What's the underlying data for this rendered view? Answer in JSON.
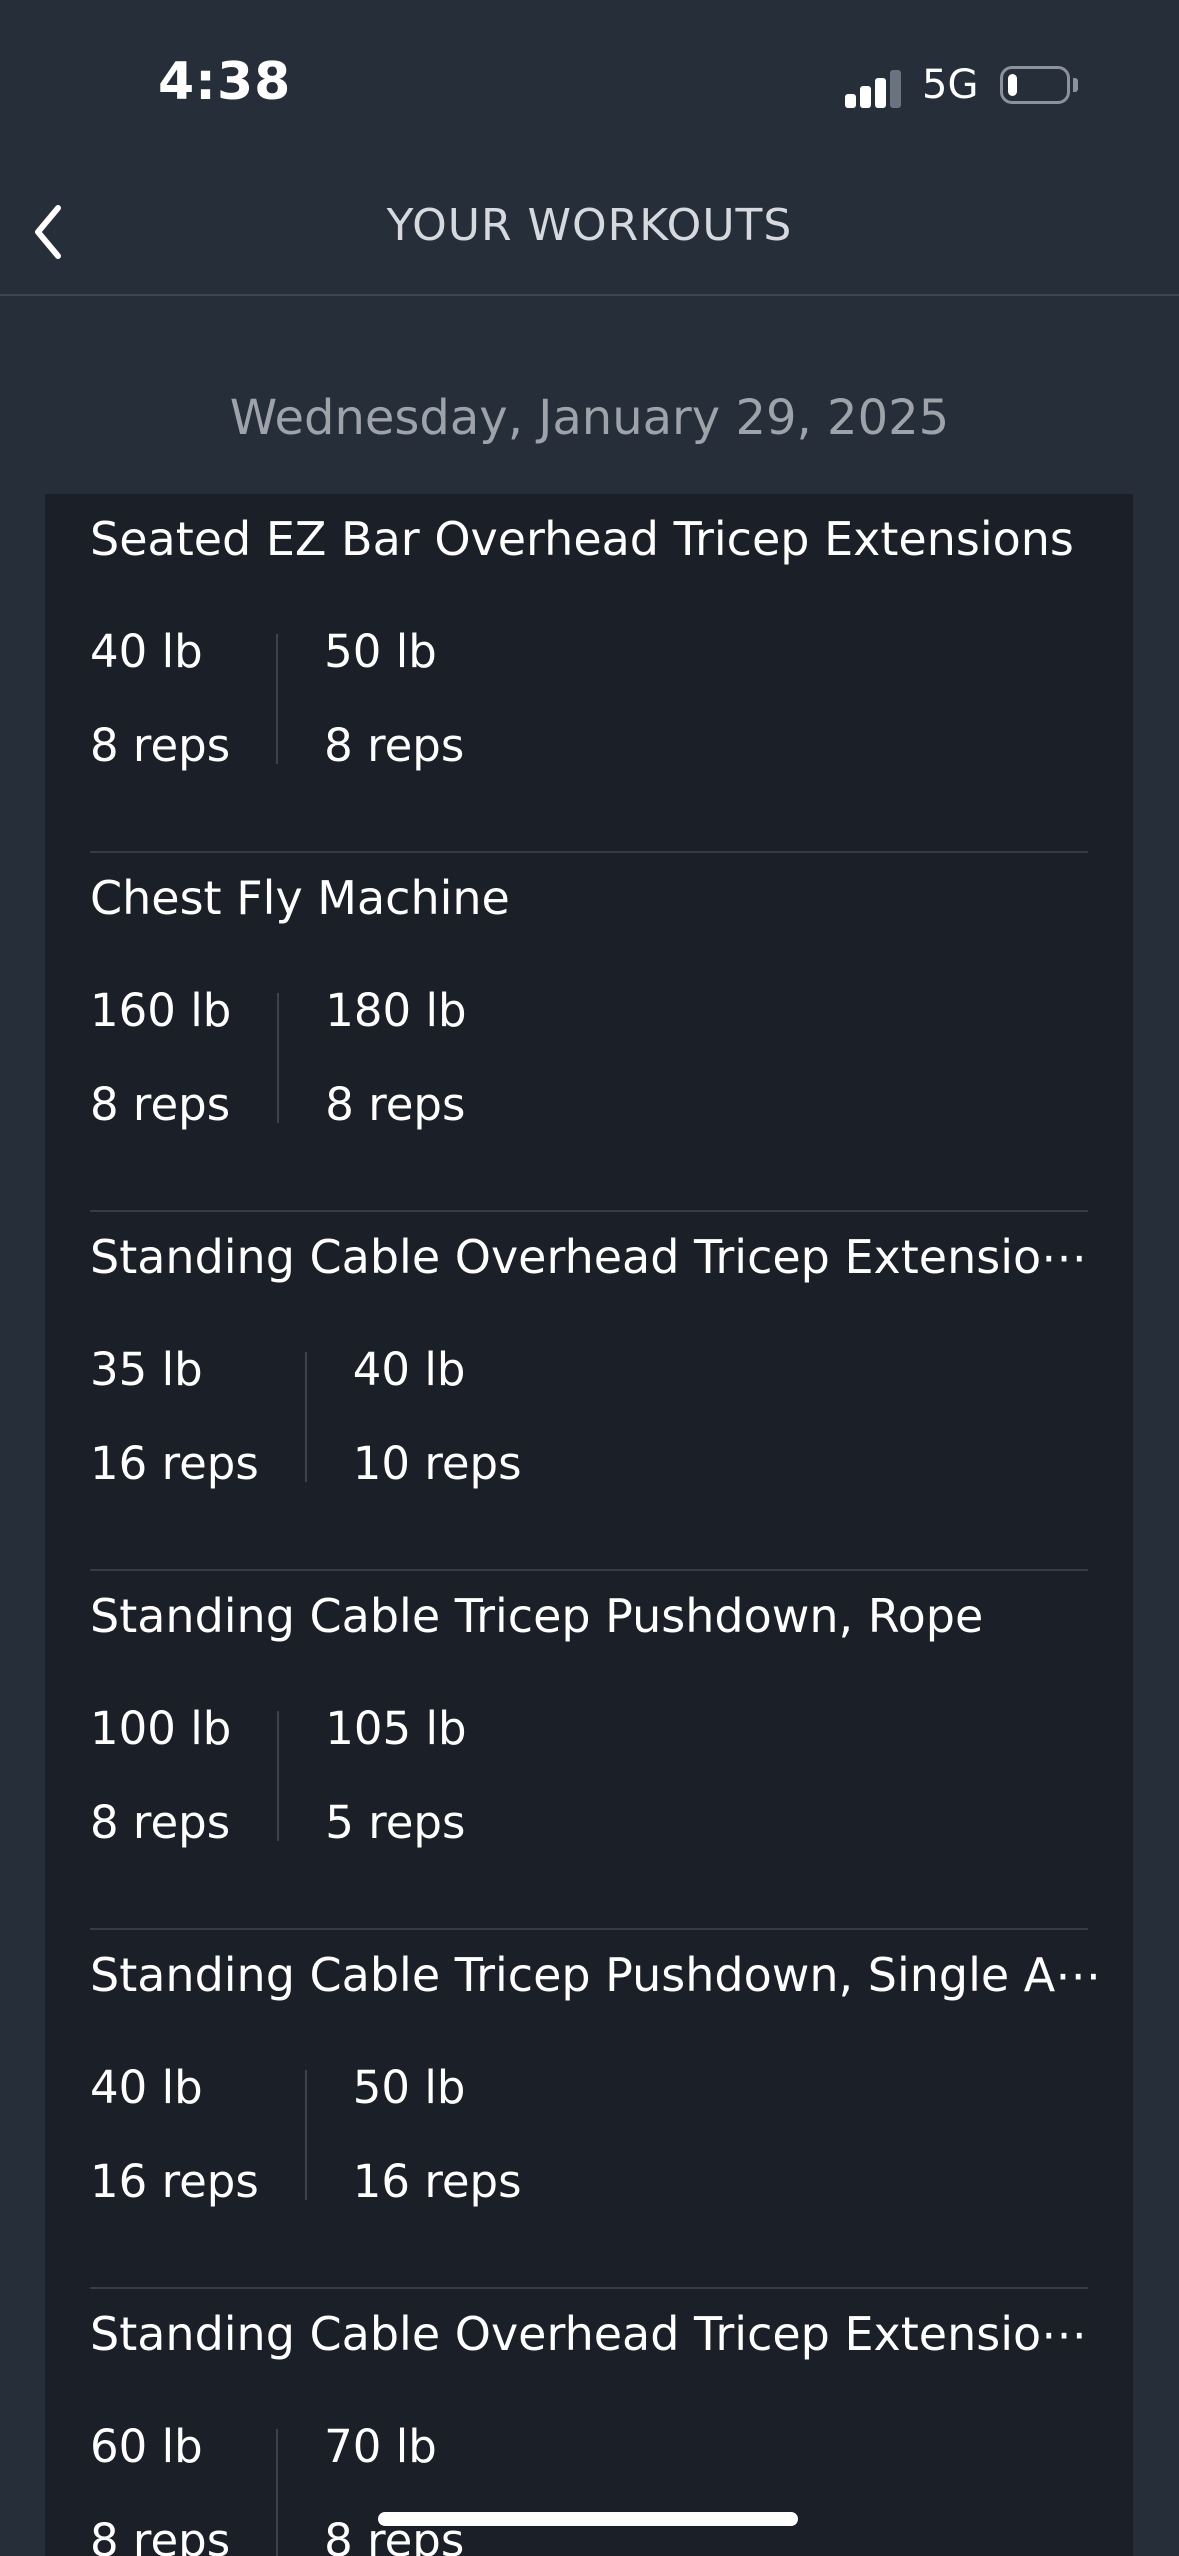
{
  "status_bar": {
    "time": "4:38",
    "network": "5G",
    "signal_bars": 3,
    "battery_level": 0.15
  },
  "header": {
    "title": "YOUR WORKOUTS",
    "back_icon": "chevron-left-icon"
  },
  "date": "Wednesday, January 29, 2025",
  "exercises": [
    {
      "name": "Seated EZ Bar Overhead Tricep Extensions",
      "sets": [
        {
          "weight": "40 lb",
          "reps": "8 reps"
        },
        {
          "weight": "50 lb",
          "reps": "8 reps"
        }
      ]
    },
    {
      "name": "Chest Fly Machine",
      "sets": [
        {
          "weight": "160 lb",
          "reps": "8 reps"
        },
        {
          "weight": "180 lb",
          "reps": "8 reps"
        }
      ]
    },
    {
      "name": "Standing Cable Overhead Tricep Extensio⋯",
      "sets": [
        {
          "weight": "35 lb",
          "reps": "16 reps"
        },
        {
          "weight": "40 lb",
          "reps": "10 reps"
        }
      ]
    },
    {
      "name": "Standing Cable Tricep Pushdown, Rope",
      "sets": [
        {
          "weight": "100 lb",
          "reps": "8 reps"
        },
        {
          "weight": "105 lb",
          "reps": "5 reps"
        }
      ]
    },
    {
      "name": "Standing Cable Tricep Pushdown, Single A⋯",
      "sets": [
        {
          "weight": "40 lb",
          "reps": "16 reps"
        },
        {
          "weight": "50 lb",
          "reps": "16 reps"
        }
      ]
    },
    {
      "name": "Standing Cable Overhead Tricep Extensio⋯",
      "sets": [
        {
          "weight": "60 lb",
          "reps": "8 reps"
        },
        {
          "weight": "70 lb",
          "reps": "8 reps"
        }
      ]
    }
  ],
  "colors": {
    "background": "#262e3a",
    "card": "#1b1f27",
    "divider": "#353c48",
    "text": "#ffffff",
    "muted_text": "#9ea3aa"
  }
}
